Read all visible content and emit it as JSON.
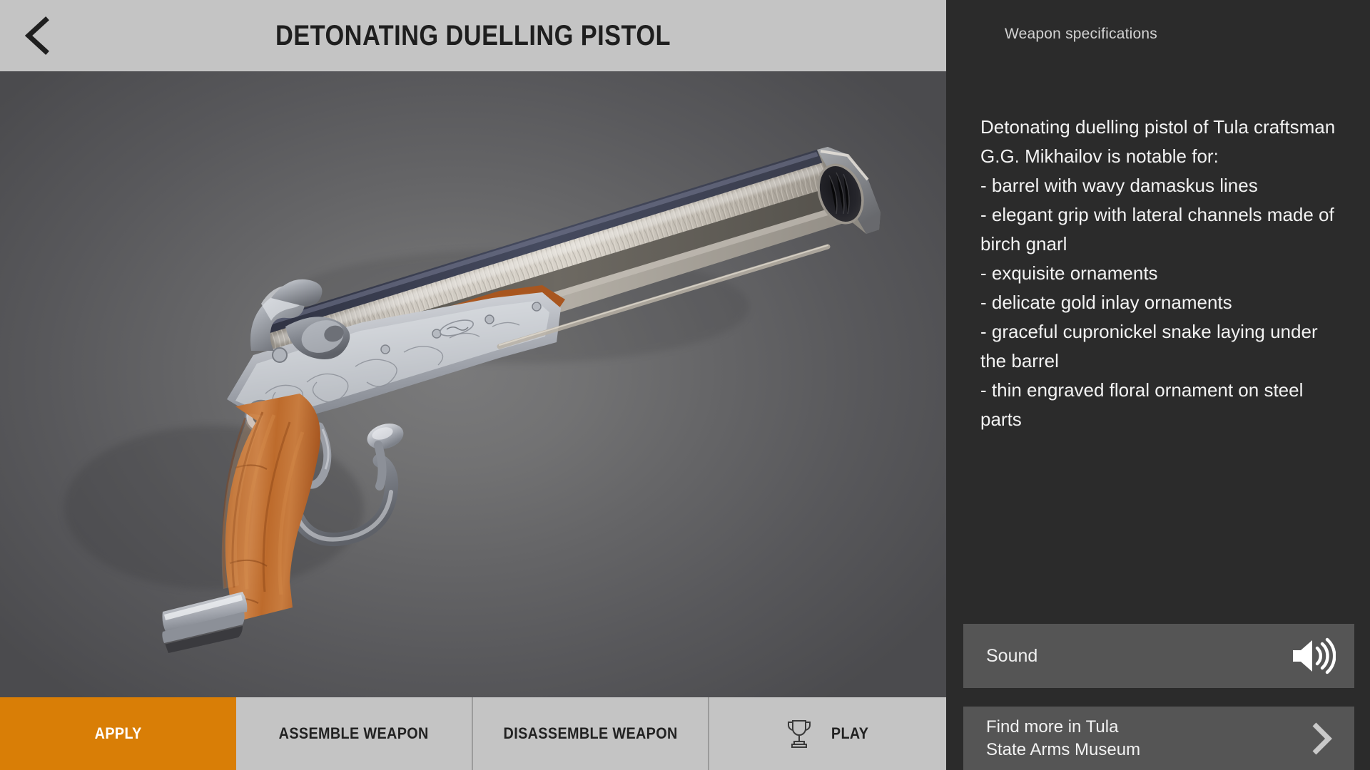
{
  "header": {
    "back_icon": "chevron-left-icon",
    "title": "DETONATING DUELLING PISTOL"
  },
  "viewport": {
    "model_name": "detonating-duelling-pistol-3d-model",
    "background_center_color": "#757576",
    "background_edge_color": "#4e4e51",
    "wood_color": "#bd6c2f",
    "wood_highlight_color": "#d08a4b",
    "steel_color": "#b9bcc2",
    "barrel_dark_color": "#3b3d4a",
    "barrel_damascus_color": "#cfcac2"
  },
  "action_bar": {
    "buttons": [
      {
        "label": "APPLY",
        "icon": null,
        "primary": true,
        "color": "#d97e06"
      },
      {
        "label": "ASSEMBLE WEAPON",
        "icon": null,
        "primary": false
      },
      {
        "label": "DISASSEMBLE WEAPON",
        "icon": null,
        "primary": false
      },
      {
        "label": "PLAY",
        "icon": "trophy-icon",
        "primary": false
      }
    ]
  },
  "right_panel": {
    "section_title": "Weapon specifications",
    "description": "Detonating duelling pistol of Tula craftsman G.G. Mikhailov is notable for:\n- barrel with wavy damaskus lines\n- elegant grip with lateral channels made of birch gnarl\n- exquisite ornaments\n- delicate gold inlay ornaments\n- graceful cupronickel snake laying under the barrel\n- thin engraved floral ornament on steel parts",
    "sound_row": {
      "label": "Sound",
      "icon": "speaker-volume-icon"
    },
    "museum_row": {
      "label": "Find more in Tula\nState Arms Museum",
      "icon": "chevron-right-icon"
    }
  }
}
